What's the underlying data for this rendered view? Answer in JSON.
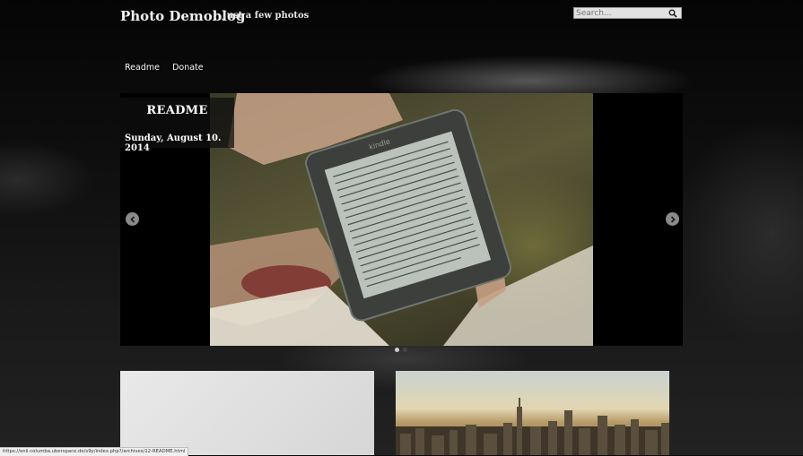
{
  "header": {
    "site_title": "Photo Demoblog",
    "tagline": "Just a few photos"
  },
  "search": {
    "placeholder": "Search...",
    "icon": "search-icon"
  },
  "nav": {
    "items": [
      {
        "label": "Readme"
      },
      {
        "label": "Donate"
      }
    ]
  },
  "slider": {
    "slide_title": "README",
    "slide_date": "Sunday, August 10. 2014",
    "kindle_brand": "kindle",
    "prev_icon": "chevron-left-icon",
    "next_icon": "chevron-right-icon",
    "active_slide": 1,
    "slide_count": 2
  },
  "colors": {
    "background": "#0a0a0a",
    "slider_bg": "#000000",
    "dot_active": "#cfcfcf",
    "dot_inactive": "#444444"
  },
  "status_bar": {
    "url": "https://onli.columba.uberspace.de/s9y/index.php?/archives/12-README.html"
  }
}
